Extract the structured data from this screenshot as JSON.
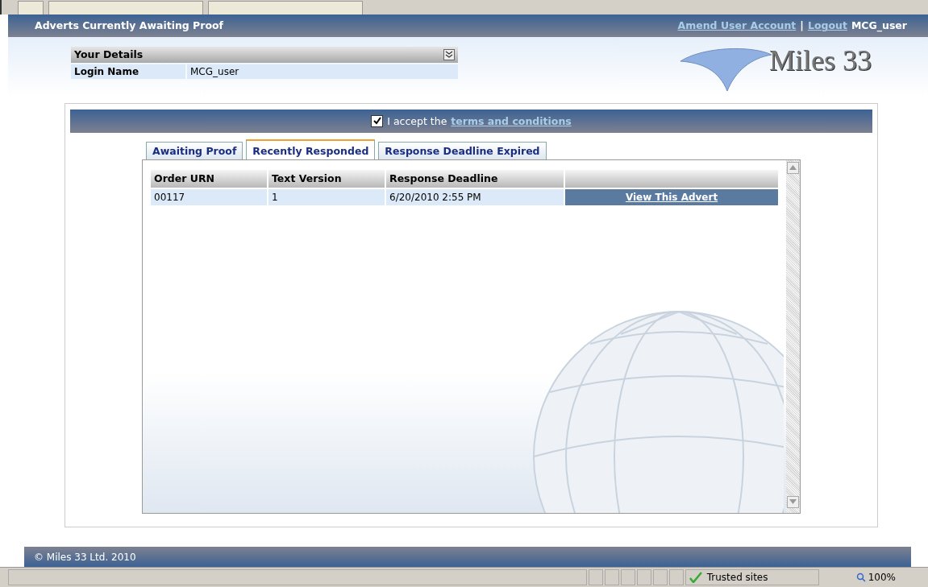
{
  "header": {
    "title": "Adverts Currently Awaiting Proof",
    "links": [
      "Amend User Account",
      "Logout"
    ],
    "separator": "|",
    "user": "MCG_user"
  },
  "details": {
    "title": "Your Details",
    "fields": [
      {
        "label": "Login Name",
        "value": "MCG_user"
      }
    ]
  },
  "logo": {
    "text": "Miles 33"
  },
  "terms": {
    "checked": true,
    "text": "I accept the",
    "link": "terms and conditions"
  },
  "tabs": [
    {
      "label": "Awaiting Proof",
      "selected": false
    },
    {
      "label": "Recently Responded",
      "selected": true
    },
    {
      "label": "Response Deadline Expired",
      "selected": false
    }
  ],
  "table": {
    "columns": [
      "Order URN",
      "Text Version",
      "Response Deadline"
    ],
    "rows": [
      {
        "order_urn": "00117",
        "text_version": "1",
        "response_deadline": "6/20/2010 2:55 PM",
        "action": "View This Advert"
      }
    ]
  },
  "footer": {
    "copyright": "© Miles 33 Ltd. 2010"
  },
  "status_bar": {
    "zone": "Trusted sites",
    "zoom": "100%"
  }
}
